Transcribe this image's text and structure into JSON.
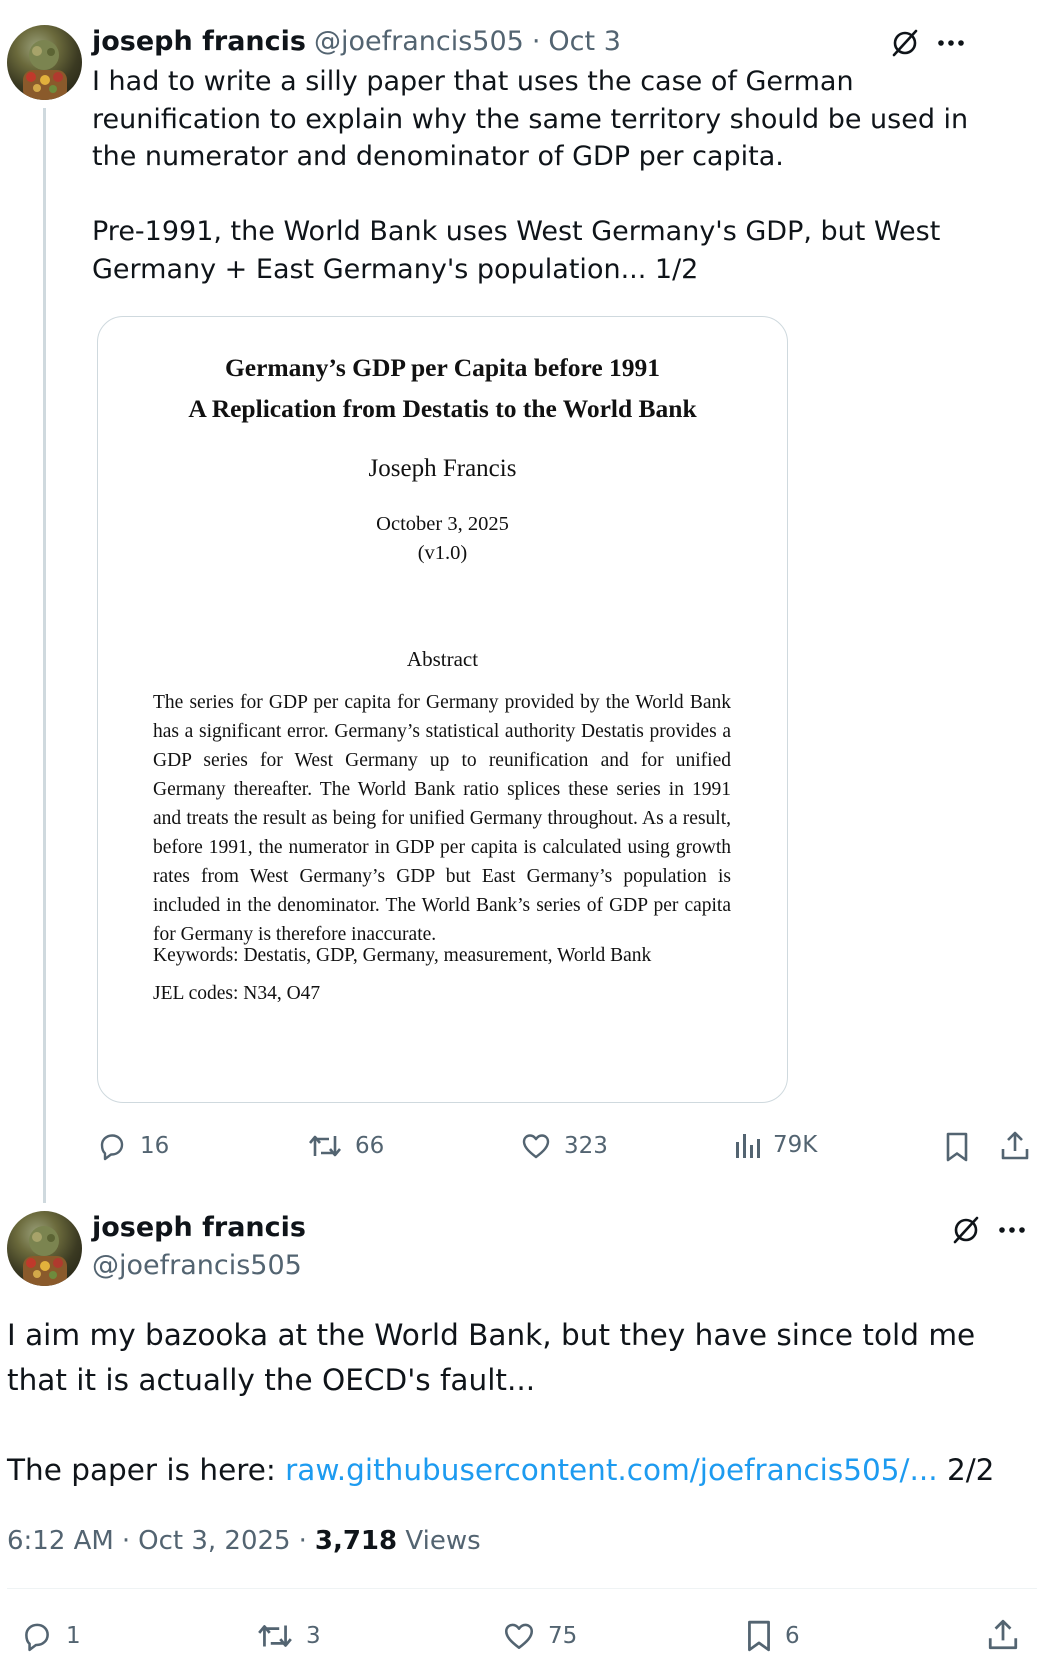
{
  "tweet1": {
    "display_name": "joseph francis",
    "handle": "@joefrancis505",
    "separator": "·",
    "date": "Oct 3",
    "text": "I had to write a silly paper that uses the case of German reunification to explain why the same territory should be used in the numerator and denominator of GDP per capita.\n\nPre-1991, the World Bank uses West Germany's GDP, but West Germany + East Germany's population... 1/2",
    "grok_icon": "slashed-circle-icon",
    "more_icon": "more-icon",
    "paper": {
      "title_line1": "Germany’s GDP per Capita before 1991",
      "title_line2": "A Replication from Destatis to the World Bank",
      "author": "Joseph Francis",
      "date": "October 3, 2025",
      "version": "(v1.0)",
      "abstract_heading": "Abstract",
      "abstract_text": "The series for GDP per capita for Germany provided by the World Bank has a significant error. Germany’s statistical authority Destatis provides a GDP series for West Germany up to reunification and for unified Germany thereafter. The World Bank ratio splices these series in 1991 and treats the result as being for unified Germany throughout. As a result, before 1991, the numerator in GDP per capita is calculated using growth rates from West Germany’s GDP but East Germany’s population is included in the denominator. The World Bank’s series of GDP per capita for Germany is therefore inaccurate.",
      "keywords": "Keywords: Destatis, GDP, Germany, measurement, World Bank",
      "jel": "JEL codes: N34, O47"
    },
    "actions": {
      "replies": "16",
      "reposts": "66",
      "likes": "323",
      "views": "79K"
    }
  },
  "tweet2": {
    "display_name": "joseph francis",
    "handle": "@joefrancis505",
    "text_line1": "I aim my bazooka at the World Bank, but they have since told me that it is actually the OECD's fault...",
    "text_prefix": "The paper is here: ",
    "link_text": "raw.githubusercontent.com/joefrancis505/...",
    "text_suffix": " 2/2",
    "time": "6:12 AM",
    "separator": "·",
    "date": "Oct 3, 2025",
    "views_count": "3,718",
    "views_label": "Views",
    "actions": {
      "replies": "1",
      "reposts": "3",
      "likes": "75",
      "bookmarks": "6"
    }
  },
  "colors": {
    "text": "#0f1419",
    "secondary": "#536471",
    "link": "#1d9bf0",
    "border": "#cfd9de"
  }
}
